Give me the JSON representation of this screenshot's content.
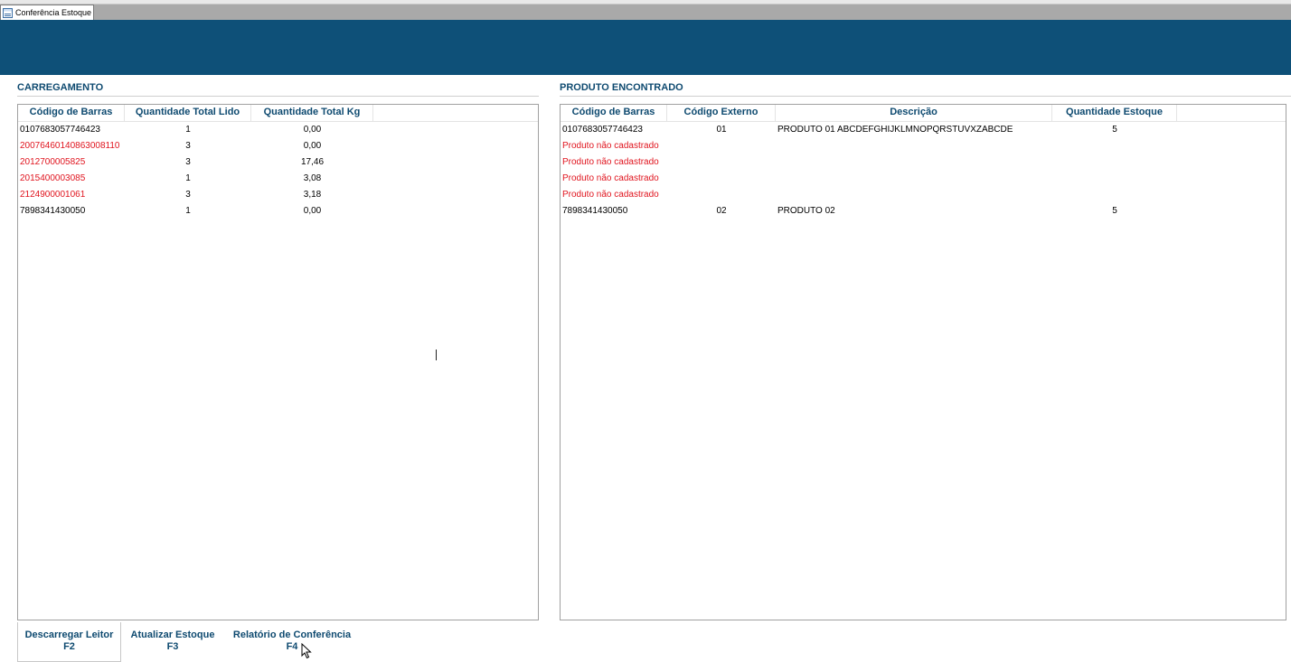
{
  "tab": {
    "title": "Conferência Estoque"
  },
  "carregamento": {
    "title": "CARREGAMENTO",
    "columns": [
      "Código de Barras",
      "Quantidade Total Lido",
      "Quantidade Total Kg"
    ],
    "rows": [
      {
        "codigo": "0107683057746423",
        "qtd_lido": "1",
        "qtd_kg": "0,00",
        "error": false
      },
      {
        "codigo": "20076460140863008110",
        "qtd_lido": "3",
        "qtd_kg": "0,00",
        "error": true
      },
      {
        "codigo": "2012700005825",
        "qtd_lido": "3",
        "qtd_kg": "17,46",
        "error": true
      },
      {
        "codigo": "2015400003085",
        "qtd_lido": "1",
        "qtd_kg": "3,08",
        "error": true
      },
      {
        "codigo": "2124900001061",
        "qtd_lido": "3",
        "qtd_kg": "3,18",
        "error": true
      },
      {
        "codigo": "7898341430050",
        "qtd_lido": "1",
        "qtd_kg": "0,00",
        "error": false
      }
    ]
  },
  "produto_encontrado": {
    "title": "PRODUTO ENCONTRADO",
    "columns": [
      "Código de Barras",
      "Código Externo",
      "Descrição",
      "Quantidade Estoque"
    ],
    "rows": [
      {
        "codigo": "0107683057746423",
        "externo": "01",
        "descricao": "PRODUTO 01 ABCDEFGHIJKLMNOPQRSTUVXZABCDE",
        "estoque": "5",
        "error": false
      },
      {
        "codigo": "Produto não cadastrado",
        "externo": "",
        "descricao": "",
        "estoque": "",
        "error": true
      },
      {
        "codigo": "Produto não cadastrado",
        "externo": "",
        "descricao": "",
        "estoque": "",
        "error": true
      },
      {
        "codigo": "Produto não cadastrado",
        "externo": "",
        "descricao": "",
        "estoque": "",
        "error": true
      },
      {
        "codigo": "Produto não cadastrado",
        "externo": "",
        "descricao": "",
        "estoque": "",
        "error": true
      },
      {
        "codigo": "7898341430050",
        "externo": "02",
        "descricao": "PRODUTO 02",
        "estoque": "5",
        "error": false
      }
    ]
  },
  "buttons": {
    "descarregar": {
      "label": "Descarregar Leitor",
      "key": "F2"
    },
    "atualizar": {
      "label": "Atualizar Estoque",
      "key": "F3"
    },
    "relatorio": {
      "label": "Relatório de Conferência",
      "key": "F4"
    }
  },
  "colors": {
    "banner": "#0e5078",
    "header_text": "#0e4a70",
    "error_text": "#e0141e"
  }
}
